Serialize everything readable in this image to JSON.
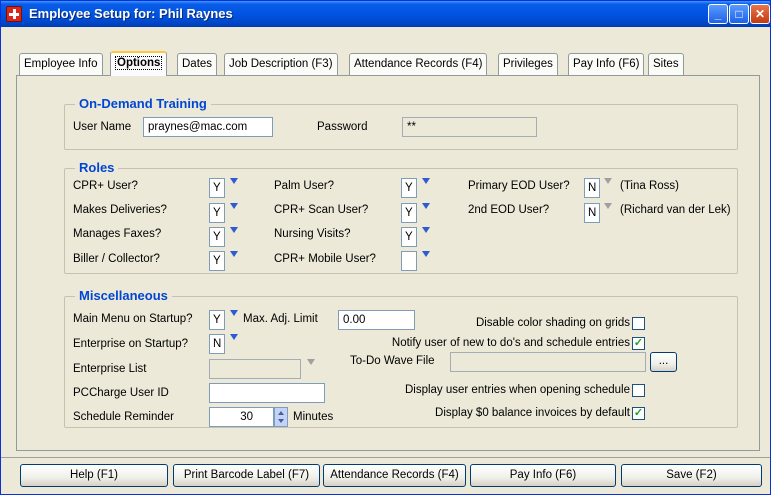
{
  "window": {
    "title": "Employee Setup for: Phil Raynes"
  },
  "titlebar_buttons": {
    "minimize": "_",
    "maximize": "□",
    "close": "✕"
  },
  "tabs": [
    {
      "label": "Employee Info"
    },
    {
      "label": "Options"
    },
    {
      "label": "Dates"
    },
    {
      "label": "Job Description (F3)"
    },
    {
      "label": "Attendance Records (F4)"
    },
    {
      "label": "Privileges"
    },
    {
      "label": "Pay Info (F6)"
    },
    {
      "label": "Sites"
    }
  ],
  "odt": {
    "title": "On-Demand Training",
    "username_label": "User Name",
    "username_value": "praynes@mac.com",
    "password_label": "Password",
    "password_value": "**"
  },
  "roles": {
    "title": "Roles",
    "cpr_user": {
      "label": "CPR+ User?",
      "value": "Y"
    },
    "makes_deliveries": {
      "label": "Makes Deliveries?",
      "value": "Y"
    },
    "manages_faxes": {
      "label": "Manages Faxes?",
      "value": "Y"
    },
    "biller_collector": {
      "label": "Biller / Collector?",
      "value": "Y"
    },
    "palm_user": {
      "label": "Palm User?",
      "value": "Y"
    },
    "cpr_scan_user": {
      "label": "CPR+ Scan User?",
      "value": "Y"
    },
    "nursing_visits": {
      "label": "Nursing Visits?",
      "value": "Y"
    },
    "cpr_mobile_user": {
      "label": "CPR+ Mobile User?",
      "value": ""
    },
    "primary_eod": {
      "label": "Primary EOD User?",
      "value": "N",
      "note": "(Tina Ross)"
    },
    "second_eod": {
      "label": "2nd EOD User?",
      "value": "N",
      "note": "(Richard van der Lek)"
    }
  },
  "misc": {
    "title": "Miscellaneous",
    "main_menu": {
      "label": "Main Menu on Startup?",
      "value": "Y"
    },
    "max_adj": {
      "label": "Max. Adj. Limit",
      "value": "0.00"
    },
    "enterprise_startup": {
      "label": "Enterprise on Startup?",
      "value": "N"
    },
    "enterprise_list": {
      "label": "Enterprise List",
      "value": ""
    },
    "pccharge": {
      "label": "PCCharge User ID",
      "value": ""
    },
    "schedule_reminder": {
      "label": "Schedule Reminder",
      "value": "30",
      "unit": "Minutes"
    },
    "disable_shading": {
      "label": "Disable color shading on grids",
      "checked": false
    },
    "notify_new": {
      "label": "Notify user of new to do's and schedule entries",
      "checked": true
    },
    "todo_wave": {
      "label": "To-Do Wave File",
      "value": "",
      "browse": "..."
    },
    "display_entries": {
      "label": "Display user entries when opening schedule",
      "checked": false
    },
    "display_zero": {
      "label": "Display $0 balance invoices by default",
      "checked": true
    }
  },
  "footer": {
    "help": "Help (F1)",
    "print": "Print Barcode Label (F7)",
    "attendance": "Attendance Records (F4)",
    "pay": "Pay Info (F6)",
    "save": "Save (F2)"
  }
}
